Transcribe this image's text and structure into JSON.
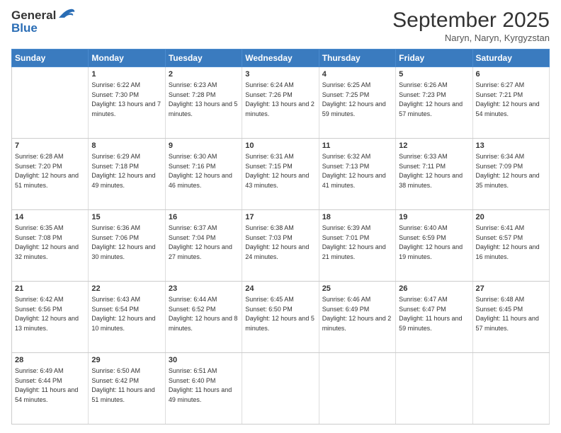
{
  "header": {
    "logo_line1": "General",
    "logo_line2": "Blue",
    "month": "September 2025",
    "location": "Naryn, Naryn, Kyrgyzstan"
  },
  "weekdays": [
    "Sunday",
    "Monday",
    "Tuesday",
    "Wednesday",
    "Thursday",
    "Friday",
    "Saturday"
  ],
  "weeks": [
    [
      null,
      {
        "day": "1",
        "sunrise": "6:22 AM",
        "sunset": "7:30 PM",
        "daylight": "13 hours and 7 minutes."
      },
      {
        "day": "2",
        "sunrise": "6:23 AM",
        "sunset": "7:28 PM",
        "daylight": "13 hours and 5 minutes."
      },
      {
        "day": "3",
        "sunrise": "6:24 AM",
        "sunset": "7:26 PM",
        "daylight": "13 hours and 2 minutes."
      },
      {
        "day": "4",
        "sunrise": "6:25 AM",
        "sunset": "7:25 PM",
        "daylight": "12 hours and 59 minutes."
      },
      {
        "day": "5",
        "sunrise": "6:26 AM",
        "sunset": "7:23 PM",
        "daylight": "12 hours and 57 minutes."
      },
      {
        "day": "6",
        "sunrise": "6:27 AM",
        "sunset": "7:21 PM",
        "daylight": "12 hours and 54 minutes."
      }
    ],
    [
      {
        "day": "7",
        "sunrise": "6:28 AM",
        "sunset": "7:20 PM",
        "daylight": "12 hours and 51 minutes."
      },
      {
        "day": "8",
        "sunrise": "6:29 AM",
        "sunset": "7:18 PM",
        "daylight": "12 hours and 49 minutes."
      },
      {
        "day": "9",
        "sunrise": "6:30 AM",
        "sunset": "7:16 PM",
        "daylight": "12 hours and 46 minutes."
      },
      {
        "day": "10",
        "sunrise": "6:31 AM",
        "sunset": "7:15 PM",
        "daylight": "12 hours and 43 minutes."
      },
      {
        "day": "11",
        "sunrise": "6:32 AM",
        "sunset": "7:13 PM",
        "daylight": "12 hours and 41 minutes."
      },
      {
        "day": "12",
        "sunrise": "6:33 AM",
        "sunset": "7:11 PM",
        "daylight": "12 hours and 38 minutes."
      },
      {
        "day": "13",
        "sunrise": "6:34 AM",
        "sunset": "7:09 PM",
        "daylight": "12 hours and 35 minutes."
      }
    ],
    [
      {
        "day": "14",
        "sunrise": "6:35 AM",
        "sunset": "7:08 PM",
        "daylight": "12 hours and 32 minutes."
      },
      {
        "day": "15",
        "sunrise": "6:36 AM",
        "sunset": "7:06 PM",
        "daylight": "12 hours and 30 minutes."
      },
      {
        "day": "16",
        "sunrise": "6:37 AM",
        "sunset": "7:04 PM",
        "daylight": "12 hours and 27 minutes."
      },
      {
        "day": "17",
        "sunrise": "6:38 AM",
        "sunset": "7:03 PM",
        "daylight": "12 hours and 24 minutes."
      },
      {
        "day": "18",
        "sunrise": "6:39 AM",
        "sunset": "7:01 PM",
        "daylight": "12 hours and 21 minutes."
      },
      {
        "day": "19",
        "sunrise": "6:40 AM",
        "sunset": "6:59 PM",
        "daylight": "12 hours and 19 minutes."
      },
      {
        "day": "20",
        "sunrise": "6:41 AM",
        "sunset": "6:57 PM",
        "daylight": "12 hours and 16 minutes."
      }
    ],
    [
      {
        "day": "21",
        "sunrise": "6:42 AM",
        "sunset": "6:56 PM",
        "daylight": "12 hours and 13 minutes."
      },
      {
        "day": "22",
        "sunrise": "6:43 AM",
        "sunset": "6:54 PM",
        "daylight": "12 hours and 10 minutes."
      },
      {
        "day": "23",
        "sunrise": "6:44 AM",
        "sunset": "6:52 PM",
        "daylight": "12 hours and 8 minutes."
      },
      {
        "day": "24",
        "sunrise": "6:45 AM",
        "sunset": "6:50 PM",
        "daylight": "12 hours and 5 minutes."
      },
      {
        "day": "25",
        "sunrise": "6:46 AM",
        "sunset": "6:49 PM",
        "daylight": "12 hours and 2 minutes."
      },
      {
        "day": "26",
        "sunrise": "6:47 AM",
        "sunset": "6:47 PM",
        "daylight": "11 hours and 59 minutes."
      },
      {
        "day": "27",
        "sunrise": "6:48 AM",
        "sunset": "6:45 PM",
        "daylight": "11 hours and 57 minutes."
      }
    ],
    [
      {
        "day": "28",
        "sunrise": "6:49 AM",
        "sunset": "6:44 PM",
        "daylight": "11 hours and 54 minutes."
      },
      {
        "day": "29",
        "sunrise": "6:50 AM",
        "sunset": "6:42 PM",
        "daylight": "11 hours and 51 minutes."
      },
      {
        "day": "30",
        "sunrise": "6:51 AM",
        "sunset": "6:40 PM",
        "daylight": "11 hours and 49 minutes."
      },
      null,
      null,
      null,
      null
    ]
  ]
}
